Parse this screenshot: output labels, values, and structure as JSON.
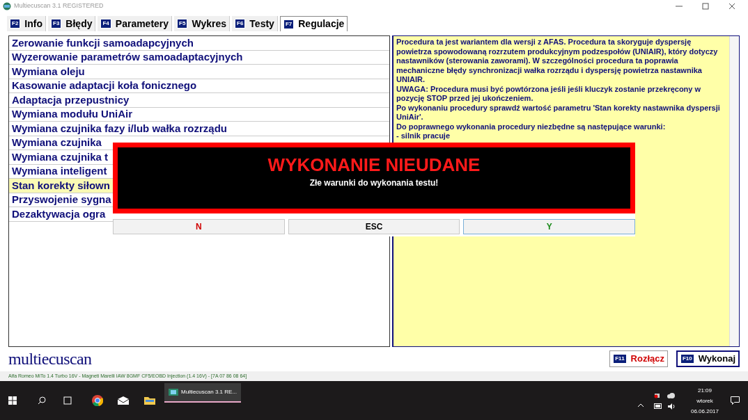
{
  "window": {
    "title": "Multiecuscan 3.1 REGISTERED"
  },
  "tabs": [
    {
      "key": "F2",
      "label": "Info",
      "selected": false
    },
    {
      "key": "F3",
      "label": "Błędy",
      "selected": false
    },
    {
      "key": "F4",
      "label": "Parametery",
      "selected": false
    },
    {
      "key": "F5",
      "label": "Wykres",
      "selected": false
    },
    {
      "key": "F6",
      "label": "Testy",
      "selected": false
    },
    {
      "key": "F7",
      "label": "Regulacje",
      "selected": true
    }
  ],
  "procedures": [
    {
      "label": "Zerowanie funkcji samoadapcyjnych",
      "selected": false
    },
    {
      "label": "Wyzerowanie parametrów samoadaptacyjnych",
      "selected": false
    },
    {
      "label": "Wymiana oleju",
      "selected": false
    },
    {
      "label": "Kasowanie adaptacji koła fonicznego",
      "selected": false
    },
    {
      "label": "Adaptacja przepustnicy",
      "selected": false
    },
    {
      "label": "Wymiana modułu UniAir",
      "selected": false
    },
    {
      "label": "Wymiana czujnika fazy i/lub wałka rozrządu",
      "selected": false
    },
    {
      "label": "Wymiana czujnika",
      "selected": false
    },
    {
      "label": "Wymiana czujnika t",
      "selected": false
    },
    {
      "label": "Wymiana inteligent",
      "selected": false
    },
    {
      "label": "Stan korekty siłown",
      "selected": true
    },
    {
      "label": "Przyswojenie sygna",
      "selected": false
    },
    {
      "label": "Dezaktywacja ogra",
      "selected": false
    }
  ],
  "description": [
    "Procedura ta jest wariantem dla wersji z AFAS. Procedura ta skoryguje dyspersję powietrza spowodowaną rozrzutem produkcyjnym podzespołów (UNIAIR), który dotyczy nastawników (sterowania zaworami). W szczególności procedura ta poprawia mechaniczne błędy synchronizacji wałka rozrządu i dyspersję powietrza nastawnika UNIAIR.",
    "UWAGA: Procedura musi być powtórzona jeśli jeśli kluczyk zostanie przekręcony w pozycję STOP przed jej ukończeniem.",
    "Po wykonaniu procedury sprawdź wartość parametru 'Stan korekty nastawnika dyspersji UniAir'.",
    "Do poprawnego wykonania procedury niezbędne są następujące warunki:",
    "- silnik pracuje"
  ],
  "dialog": {
    "title": "WYKONANIE NIEUDANE",
    "message": "Złe warunki do wykonania testu!",
    "buttons": [
      {
        "label": "N",
        "kind": "no",
        "selected": false
      },
      {
        "label": "ESC",
        "kind": "cancel",
        "selected": false
      },
      {
        "label": "Y",
        "kind": "yes",
        "selected": true
      }
    ]
  },
  "logo": "multiecuscan",
  "actions": [
    {
      "key": "F11",
      "label": "Rozłącz",
      "kind": "disconnect"
    },
    {
      "key": "F10",
      "label": "Wykonaj",
      "kind": "execute"
    }
  ],
  "status_bar": "Alfa Romeo MiTo 1.4 Turbo 16V - Magneti Marelli IAW 8GMF CF5/EOBD Injection (1.4 16V) - [7A 07 86 08 64]",
  "taskbar": {
    "app": "Multiecuscan 3.1 RE...",
    "time": "21:09",
    "day": "wtorek",
    "date": "06.06.2017"
  }
}
